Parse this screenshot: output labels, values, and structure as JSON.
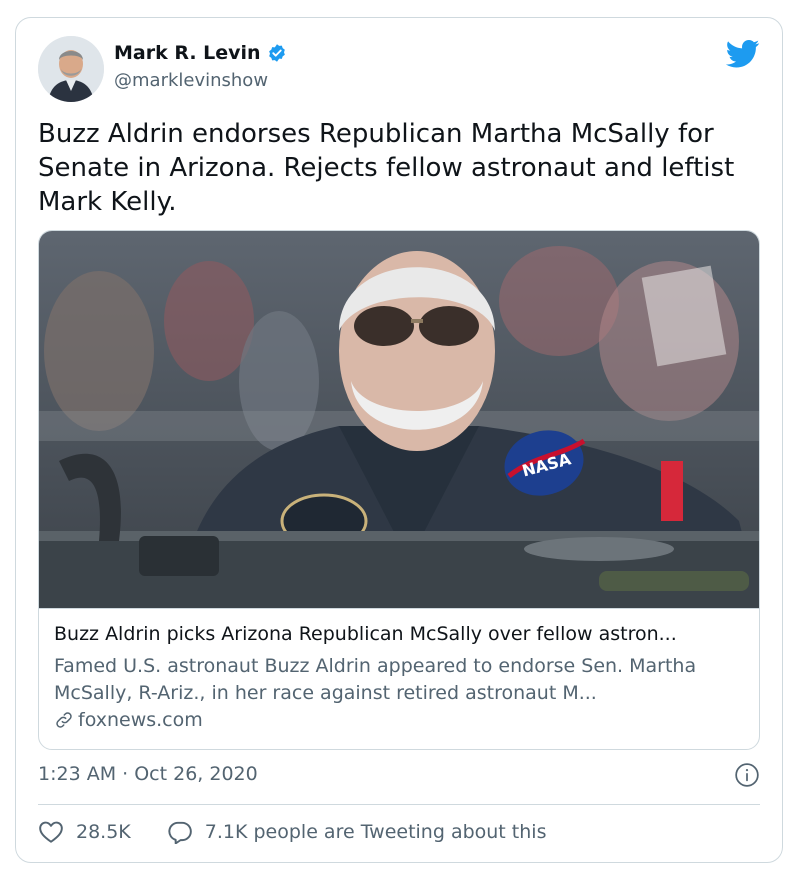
{
  "author": {
    "display_name": "Mark R. Levin",
    "handle": "@marklevinshow",
    "verified": true
  },
  "tweet": {
    "text": "Buzz Aldrin endorses Republican Martha McSally for Senate in Arizona. Rejects fellow astronaut and leftist Mark Kelly.",
    "timestamp": "1:23 AM · Oct 26, 2020"
  },
  "link_card": {
    "title": "Buzz Aldrin picks Arizona Republican McSally over fellow astron...",
    "description": "Famed U.S. astronaut Buzz Aldrin appeared to endorse Sen. Martha McSally, R-Ariz., in her race against retired astronaut M...",
    "domain": "foxnews.com",
    "image_badge_text": "NASA"
  },
  "actions": {
    "likes_count": "28.5K",
    "conversation_text": "7.1K people are Tweeting about this"
  },
  "icons": {
    "verified": "verified-badge-icon",
    "bird": "twitter-bird-icon",
    "info": "info-icon",
    "heart": "heart-icon",
    "reply": "speech-bubble-icon",
    "link": "link-icon"
  },
  "colors": {
    "brand_blue": "#1d9bf0",
    "text_primary": "#0f1419",
    "text_secondary": "#536471",
    "border": "#cfd9de"
  }
}
